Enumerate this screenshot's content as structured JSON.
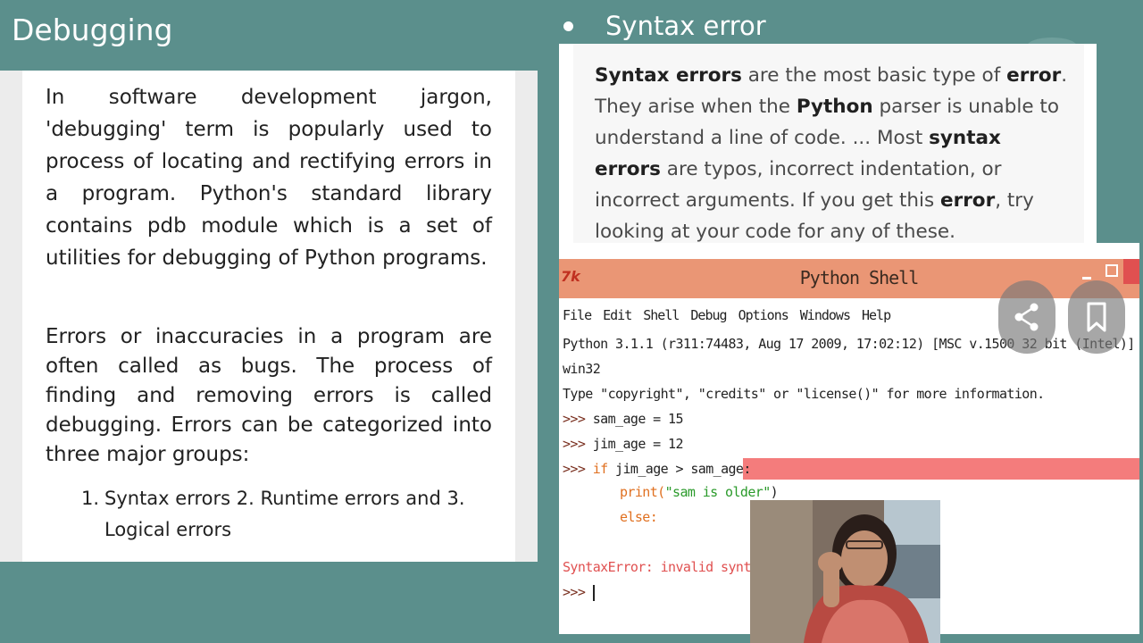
{
  "slide": {
    "title": "Debugging",
    "intro_paragraph": "In software development jargon, 'debugging' term is popularly used to process of locating and rectifying errors in a program. Python's standard library contains pdb module which is a set of utilities for debugging of Python programs.",
    "errors_paragraph": "Errors or inaccuracies in a program are often called as bugs. The process of finding and removing errors is called debugging. Errors can be categorized into three major groups:",
    "list": [
      {
        "number": "1.",
        "text": "Syntax errors 2. Runtime errors and 3. Logical errors"
      }
    ],
    "bullet_heading": "Syntax error"
  },
  "syntax_card": {
    "s1_bold": "Syntax errors",
    "s1_text": " are the most basic type of ",
    "s1_bold2": "error",
    "s1_end": ". They arise when the ",
    "s2_bold": "Python",
    "s2_text": " parser is unable to understand a line of code. ... Most ",
    "s3_bold": "syntax errors",
    "s3_text": " are typos, incorrect indentation, or incorrect arguments. If you get this ",
    "s4_bold": "error",
    "s4_text": ", try looking at your code for any of these."
  },
  "shell": {
    "logo": "7k",
    "window_title": "Python Shell",
    "menu": [
      "File",
      "Edit",
      "Shell",
      "Debug",
      "Options",
      "Windows",
      "Help"
    ],
    "lines": {
      "banner1": "Python 3.1.1 (r311:74483, Aug 17 2009, 17:02:12) [MSC v.1500 32 bit (Intel)] on",
      "banner2": "win32",
      "banner3": "Type \"copyright\", \"credits\" or \"license()\" for more information.",
      "prompt": ">>> ",
      "l1": "sam_age = 15",
      "l2": "jim_age = 12",
      "l3_kw": "if",
      "l3": " jim_age > sam_age:",
      "l4_fn": "print(",
      "l4_str": "\"sam is older\"",
      "l4_end": ")",
      "l5_kw": "else:",
      "error": "SyntaxError: invalid syntax"
    }
  },
  "icons": {
    "share": "share-icon",
    "bookmark": "bookmark-icon"
  },
  "colors": {
    "background": "#5b8f8c",
    "titlebar": "#ea9675",
    "highlight": "#f47c7c"
  }
}
